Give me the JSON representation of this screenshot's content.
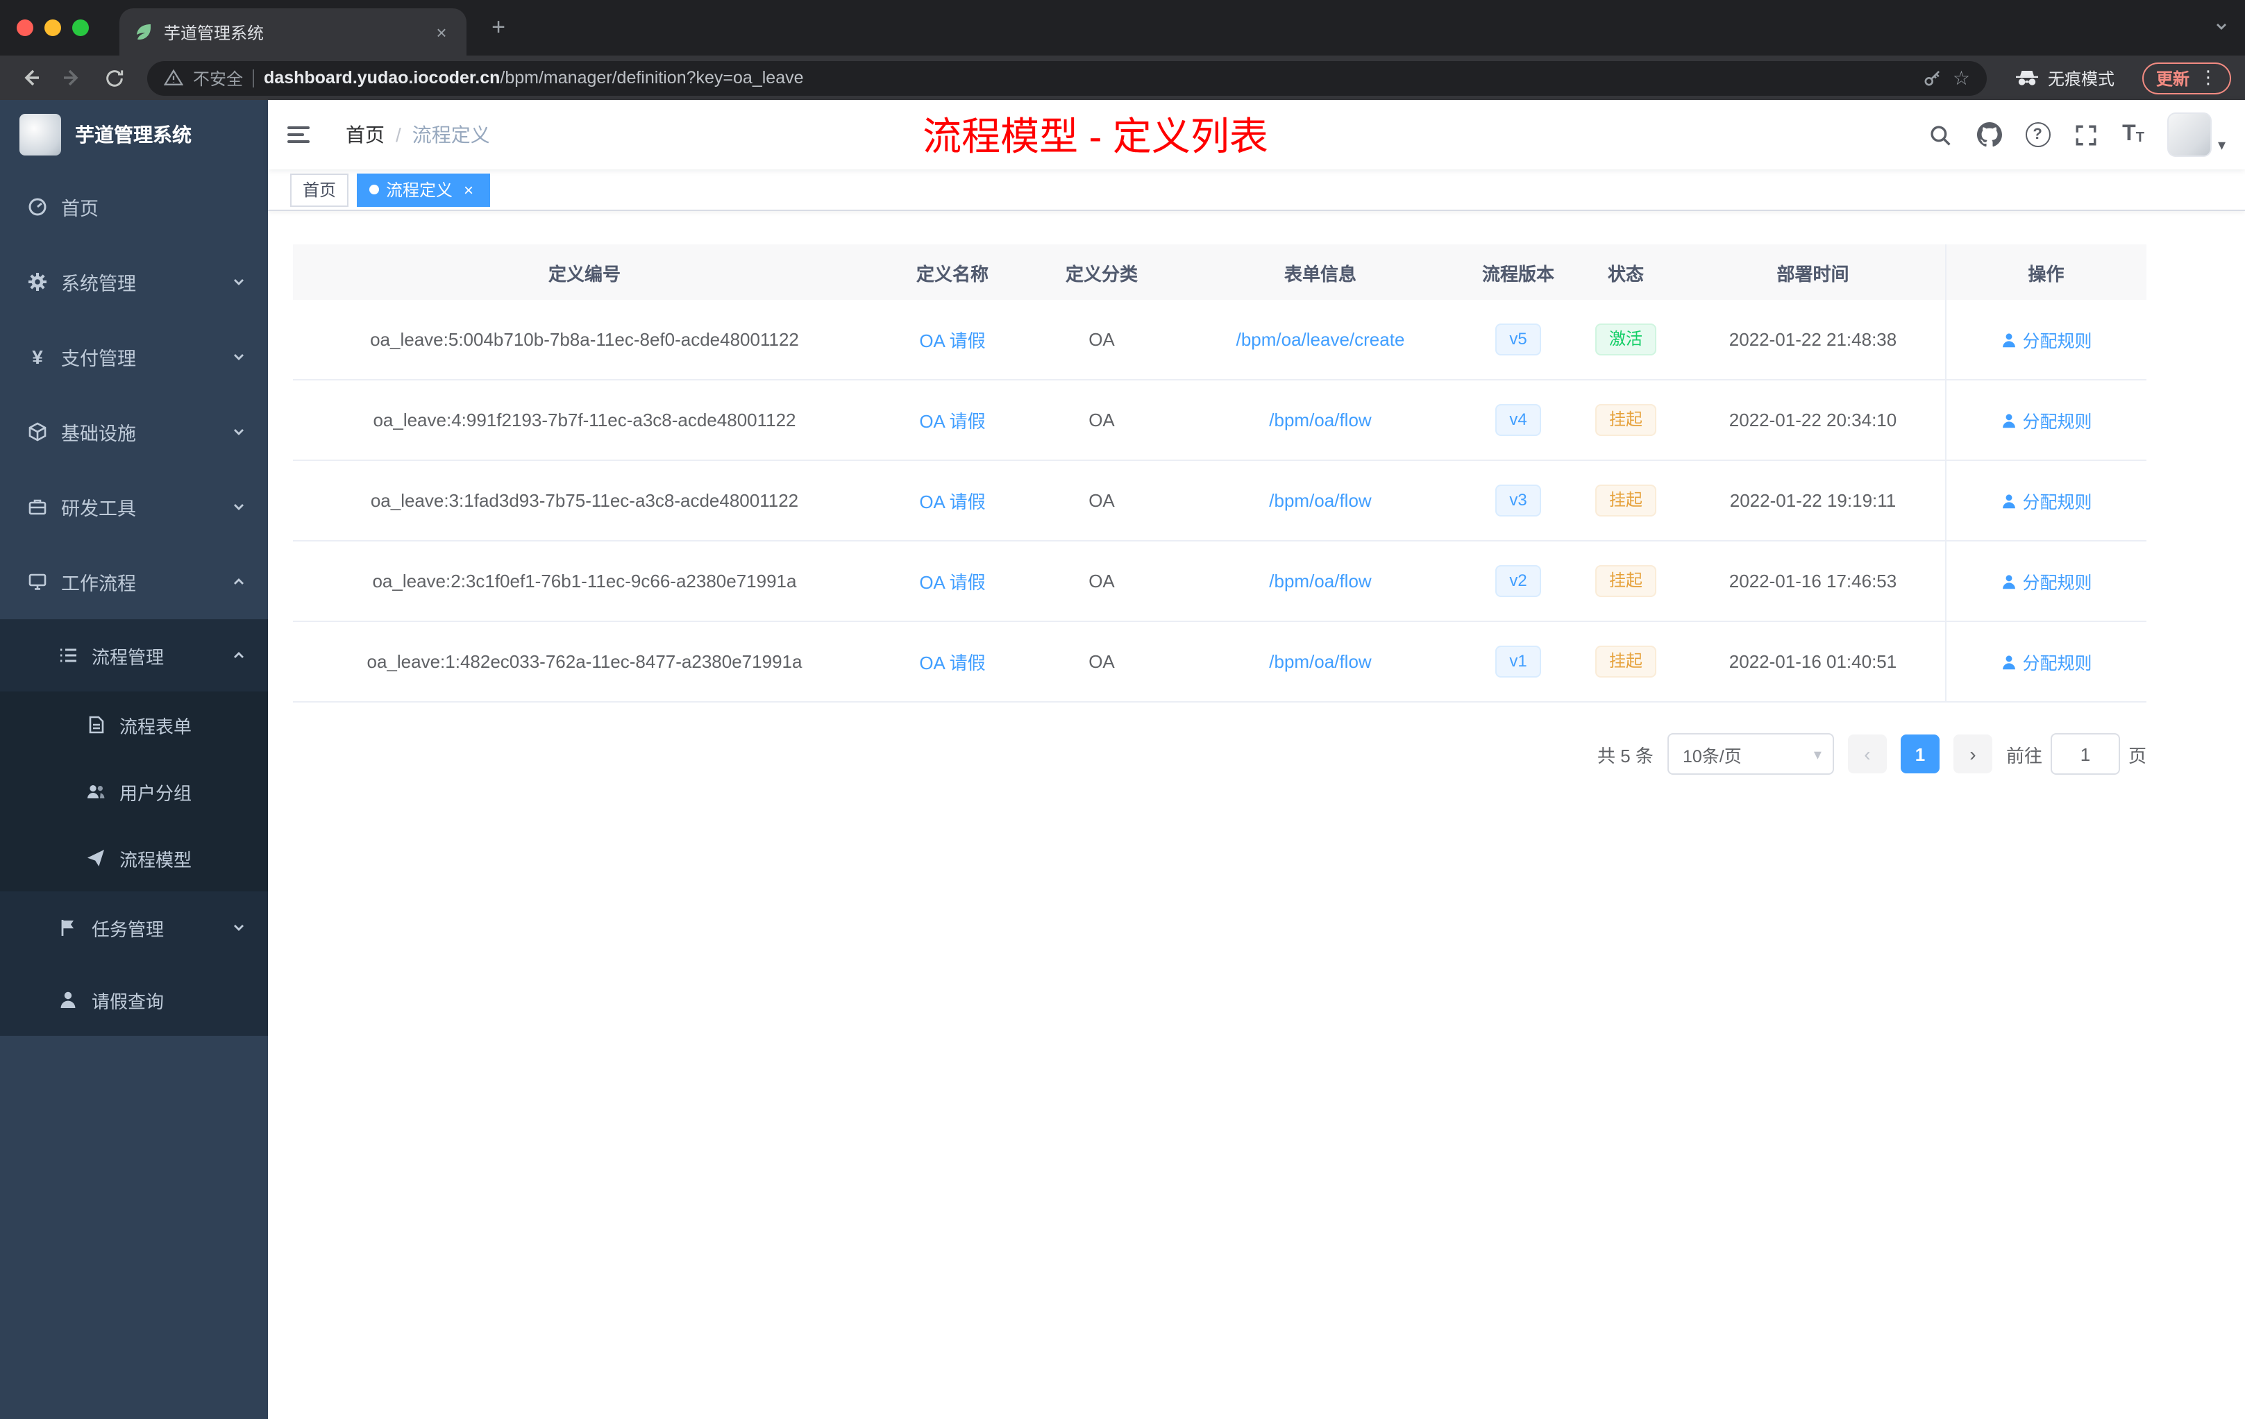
{
  "browser": {
    "tab_title": "芋道管理系统",
    "security_label": "不安全",
    "url_domain": "dashboard.yudao.iocoder.cn",
    "url_path": "/bpm/manager/definition?key=oa_leave",
    "incognito_label": "无痕模式",
    "update_label": "更新"
  },
  "sidebar": {
    "logo_title": "芋道管理系统",
    "items": [
      {
        "label": "首页"
      },
      {
        "label": "系统管理"
      },
      {
        "label": "支付管理"
      },
      {
        "label": "基础设施"
      },
      {
        "label": "研发工具"
      },
      {
        "label": "工作流程"
      },
      {
        "label": "流程管理"
      },
      {
        "label": "流程表单"
      },
      {
        "label": "用户分组"
      },
      {
        "label": "流程模型"
      },
      {
        "label": "任务管理"
      },
      {
        "label": "请假查询"
      }
    ]
  },
  "header": {
    "breadcrumb_home": "首页",
    "breadcrumb_separator": "/",
    "breadcrumb_current": "流程定义",
    "annotation": "流程模型 - 定义列表"
  },
  "tags": {
    "home": "首页",
    "active": "流程定义"
  },
  "table": {
    "headers": [
      "定义编号",
      "定义名称",
      "定义分类",
      "表单信息",
      "流程版本",
      "状态",
      "部署时间",
      "操作"
    ],
    "rows": [
      {
        "id": "oa_leave:5:004b710b-7b8a-11ec-8ef0-acde48001122",
        "name": "OA 请假",
        "category": "OA",
        "form": "/bpm/oa/leave/create",
        "version": "v5",
        "status": "激活",
        "status_type": "active",
        "time": "2022-01-22 21:48:38",
        "action": "分配规则"
      },
      {
        "id": "oa_leave:4:991f2193-7b7f-11ec-a3c8-acde48001122",
        "name": "OA 请假",
        "category": "OA",
        "form": "/bpm/oa/flow",
        "version": "v4",
        "status": "挂起",
        "status_type": "suspended",
        "time": "2022-01-22 20:34:10",
        "action": "分配规则"
      },
      {
        "id": "oa_leave:3:1fad3d93-7b75-11ec-a3c8-acde48001122",
        "name": "OA 请假",
        "category": "OA",
        "form": "/bpm/oa/flow",
        "version": "v3",
        "status": "挂起",
        "status_type": "suspended",
        "time": "2022-01-22 19:19:11",
        "action": "分配规则"
      },
      {
        "id": "oa_leave:2:3c1f0ef1-76b1-11ec-9c66-a2380e71991a",
        "name": "OA 请假",
        "category": "OA",
        "form": "/bpm/oa/flow",
        "version": "v2",
        "status": "挂起",
        "status_type": "suspended",
        "time": "2022-01-16 17:46:53",
        "action": "分配规则"
      },
      {
        "id": "oa_leave:1:482ec033-762a-11ec-8477-a2380e71991a",
        "name": "OA 请假",
        "category": "OA",
        "form": "/bpm/oa/flow",
        "version": "v1",
        "status": "挂起",
        "status_type": "suspended",
        "time": "2022-01-16 01:40:51",
        "action": "分配规则"
      }
    ]
  },
  "pagination": {
    "total": "共 5 条",
    "page_size": "10条/页",
    "prev": "‹",
    "current_page": "1",
    "next": "›",
    "goto_label": "前往",
    "goto_value": "1",
    "page_suffix": "页"
  },
  "colors": {
    "accent": "#409EFF",
    "success": "#13CE66",
    "warning": "#E6A23C",
    "annotation": "#FF0000",
    "sidebar_bg": "#304156"
  }
}
